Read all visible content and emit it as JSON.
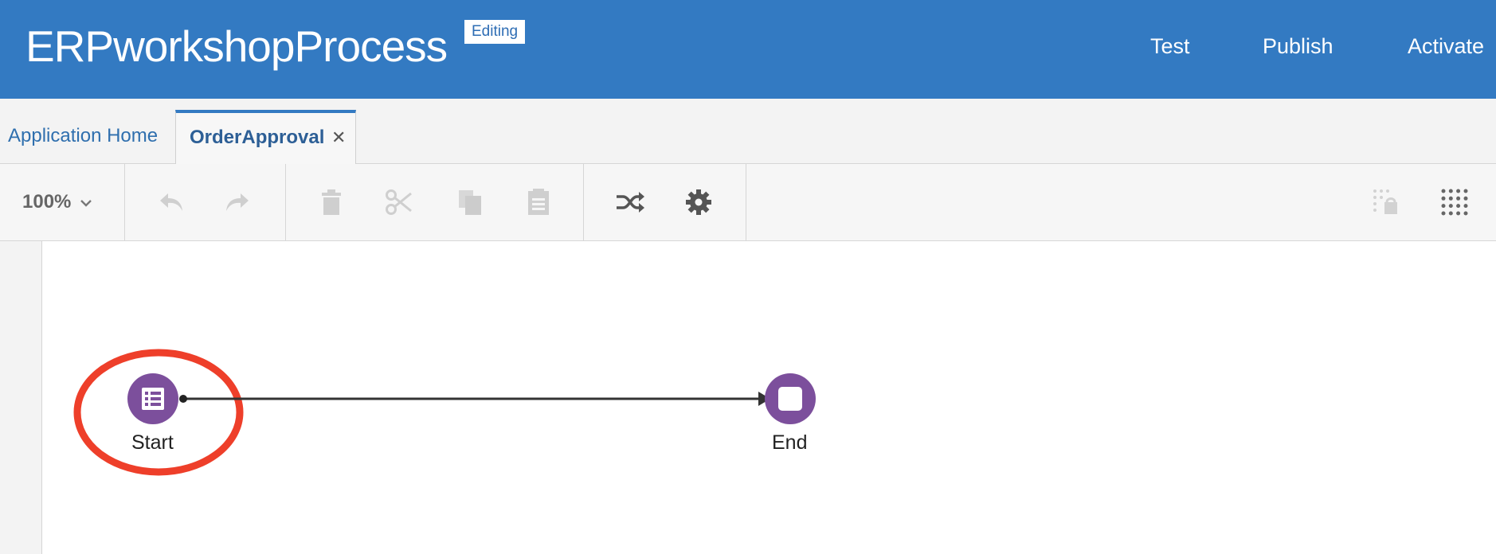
{
  "header": {
    "app_title": "ERPworkshopProcess",
    "status_badge": "Editing",
    "actions": {
      "test": "Test",
      "publish": "Publish",
      "activate": "Activate"
    }
  },
  "tabs": {
    "home": "Application Home",
    "active": "OrderApproval",
    "close_glyph": "✕"
  },
  "toolbar": {
    "zoom_value": "100%",
    "buttons": [
      {
        "name": "undo",
        "icon": "undo-icon",
        "enabled": false
      },
      {
        "name": "redo",
        "icon": "redo-icon",
        "enabled": false
      },
      {
        "name": "delete",
        "icon": "trash-icon",
        "enabled": false
      },
      {
        "name": "cut",
        "icon": "scissors-icon",
        "enabled": false
      },
      {
        "name": "copy",
        "icon": "copy-icon",
        "enabled": false
      },
      {
        "name": "paste",
        "icon": "paste-icon",
        "enabled": false
      },
      {
        "name": "data-association",
        "icon": "shuffle-icon",
        "enabled": true
      },
      {
        "name": "settings",
        "icon": "gear-icon",
        "enabled": true
      },
      {
        "name": "lock",
        "icon": "lock-grid-icon",
        "enabled": false
      },
      {
        "name": "grid",
        "icon": "grid-dots-icon",
        "enabled": true
      }
    ]
  },
  "process": {
    "nodes": [
      {
        "id": "start",
        "label": "Start",
        "type": "start-form",
        "highlighted": true
      },
      {
        "id": "end",
        "label": "End",
        "type": "end"
      }
    ],
    "edges": [
      {
        "from": "start",
        "to": "end"
      }
    ]
  },
  "colors": {
    "header_bg": "#337AC2",
    "node_purple": "#7C4F9C",
    "highlight_red": "#EE3F2A"
  }
}
